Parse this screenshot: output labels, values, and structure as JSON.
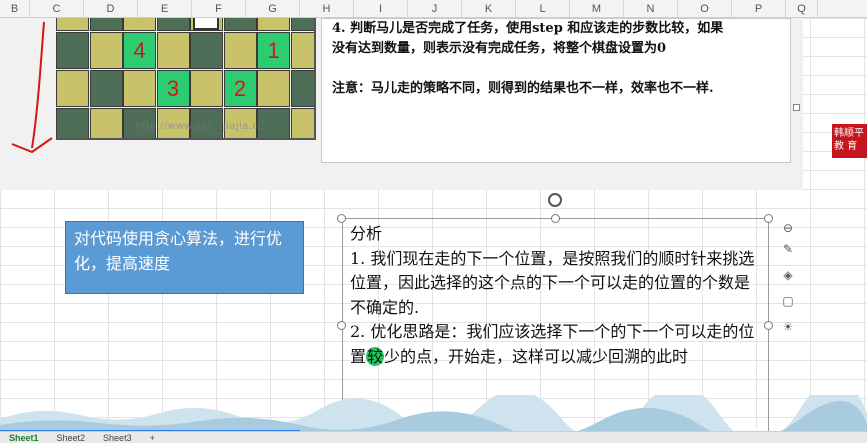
{
  "column_headers": [
    "B",
    "C",
    "D",
    "E",
    "F",
    "G",
    "H",
    "I",
    "J",
    "K",
    "L",
    "M",
    "N",
    "O",
    "P",
    "Q"
  ],
  "chessboard": {
    "labels": [
      {
        "text": "4",
        "row": 0,
        "col": 2
      },
      {
        "text": "1",
        "row": 0,
        "col": 6
      },
      {
        "text": "3",
        "row": 1,
        "col": 3
      },
      {
        "text": "2",
        "row": 1,
        "col": 5
      }
    ],
    "watermark": "http://www.cai...jiajia.c..."
  },
  "note": {
    "line1": "4. 判断马儿是否完成了任务，使用step 和应该走的步数比较，如果",
    "line2": "没有达到数量，则表示没有完成任务，将整个棋盘设置为0",
    "line3": "注意：马儿走的策略不同，则得到的结果也不一样，效率也不一样."
  },
  "logo": {
    "line1": "韩顺平",
    "line2": "教  育"
  },
  "blue_box": {
    "text": "对代码使用贪心算法，进行优化，提高速度"
  },
  "analysis": {
    "title": "分析",
    "p1": "1. 我们现在走的下一个位置，是按照我们的顺时针来挑选位置，因此选择的这个点的下一个可以走的位置的个数是不确定的.",
    "p2_before": "2. 优化思路是：我们应该选择下一个的下一个可以走的位置",
    "p2_highlight": "较",
    "p2_after": "少的点，开始走，这样可以减少回溯的此时"
  },
  "sheet_tabs": [
    "Sheet1",
    "Sheet2",
    "Sheet3",
    "+"
  ],
  "colors": {
    "dark_square": "#4e6e58",
    "light_square": "#c8c26a",
    "green_square": "#2ecc71",
    "label_red": "#cc1a1a",
    "blue_box": "#5b9bd5"
  }
}
